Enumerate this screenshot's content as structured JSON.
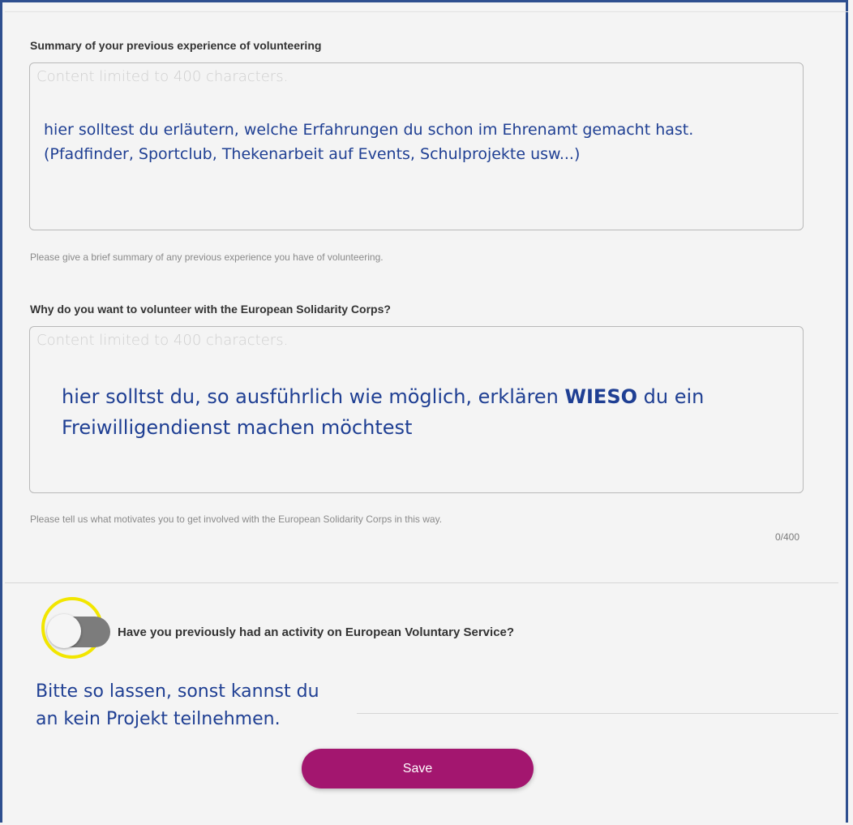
{
  "section1": {
    "label": "Summary of your previous experience of volunteering",
    "placeholder": "Content limited to 400 characters.",
    "annotation_line1": "hier solltest du erläutern, welche Erfahrungen du schon im Ehrenamt gemacht hast.",
    "annotation_line2": "(Pfadfinder, Sportclub, Thekenarbeit auf Events, Schulprojekte usw...)",
    "help": "Please give a brief summary of any previous experience you have of volunteering."
  },
  "section2": {
    "label": "Why do you want to volunteer with the European Solidarity Corps?",
    "placeholder": "Content limited to 400 characters.",
    "annotation_before": "hier solltst du, so ausführlich wie möglich, erklären ",
    "annotation_bold": "WIESO",
    "annotation_after": " du ein",
    "annotation_line2": "Freiwilligendienst machen möchtest",
    "help": "Please tell us what motivates you to get involved with the European Solidarity Corps in this way.",
    "counter": "0/400"
  },
  "evs_toggle": {
    "label": "Have you previously had an activity on European Voluntary Service?",
    "state": "off",
    "annotation_line1": "Bitte so lassen, sonst kannst du",
    "annotation_line2": "an kein Projekt teilnehmen."
  },
  "save_button": {
    "label": "Save"
  },
  "colors": {
    "annotation": "#1f3f93",
    "highlight_ring": "#f2e600",
    "save_button": "#a3166f",
    "frame": "#2e4f8f"
  }
}
